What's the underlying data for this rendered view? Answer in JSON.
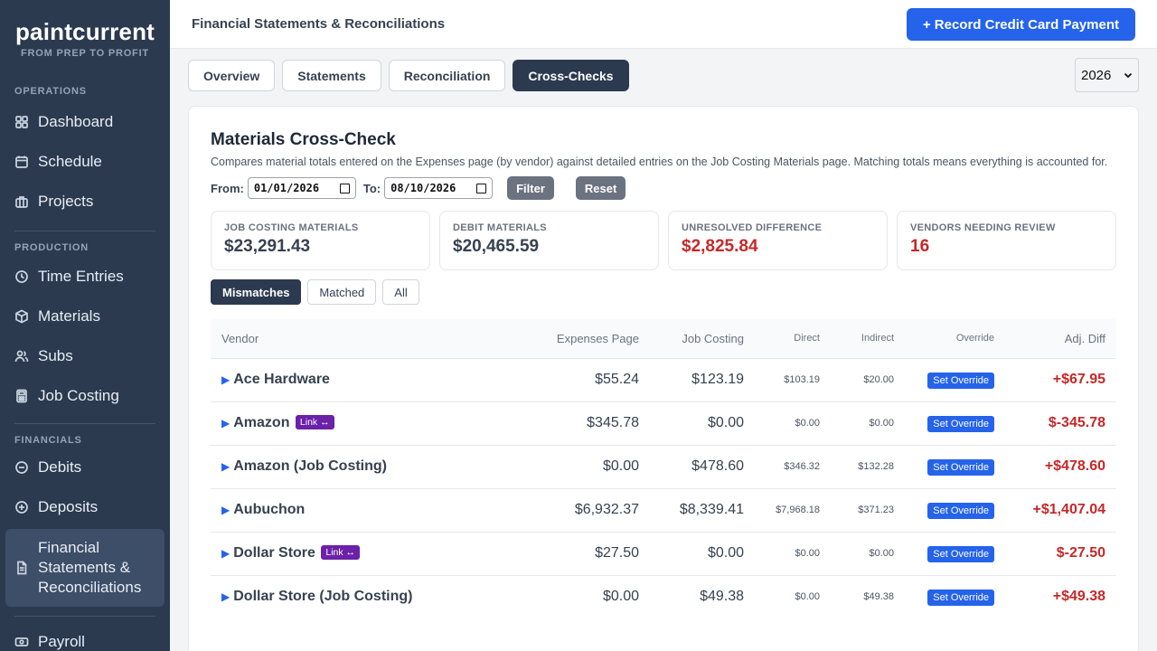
{
  "brand": {
    "name": "paintcurrent",
    "tagline": "FROM PREP TO PROFIT"
  },
  "sidebar": {
    "sections": [
      {
        "label": "OPERATIONS",
        "items": [
          {
            "label": "Dashboard",
            "icon": "grid-icon"
          },
          {
            "label": "Schedule",
            "icon": "calendar-icon"
          },
          {
            "label": "Projects",
            "icon": "briefcase-icon"
          }
        ]
      },
      {
        "label": "PRODUCTION",
        "items": [
          {
            "label": "Time Entries",
            "icon": "clock-icon"
          },
          {
            "label": "Materials",
            "icon": "box-icon"
          },
          {
            "label": "Subs",
            "icon": "users-icon"
          },
          {
            "label": "Job Costing",
            "icon": "calculator-icon"
          }
        ]
      },
      {
        "label": "FINANCIALS",
        "items": [
          {
            "label": "Debits",
            "icon": "minus-circle-icon"
          },
          {
            "label": "Deposits",
            "icon": "plus-circle-icon"
          },
          {
            "label": "Financial Statements & Reconciliations",
            "icon": "document-icon",
            "active": true
          }
        ]
      }
    ],
    "footer_item": {
      "label": "Payroll",
      "icon": "payroll-icon"
    }
  },
  "header": {
    "title": "Financial Statements & Reconciliations",
    "primary_button": "+ Record Credit Card Payment"
  },
  "tabs": [
    {
      "label": "Overview"
    },
    {
      "label": "Statements"
    },
    {
      "label": "Reconciliation"
    },
    {
      "label": "Cross-Checks",
      "active": true
    }
  ],
  "year_select": {
    "value": "2026"
  },
  "card": {
    "title": "Materials Cross-Check",
    "description": "Compares material totals entered on the Expenses page (by vendor) against detailed entries on the Job Costing Materials page. Matching totals means everything is accounted for.",
    "filter": {
      "from_label": "From:",
      "from_value": "01/01/2026",
      "to_label": "To:",
      "to_value": "08/10/2026",
      "filter_button": "Filter",
      "reset_button": "Reset"
    },
    "stats": [
      {
        "label": "JOB COSTING MATERIALS",
        "value": "$23,291.43",
        "red": false
      },
      {
        "label": "DEBIT MATERIALS",
        "value": "$20,465.59",
        "red": false
      },
      {
        "label": "UNRESOLVED DIFFERENCE",
        "value": "$2,825.84",
        "red": true
      },
      {
        "label": "VENDORS NEEDING REVIEW",
        "value": "16",
        "red": true
      }
    ],
    "view_toggle": [
      {
        "label": "Mismatches",
        "active": true
      },
      {
        "label": "Matched"
      },
      {
        "label": "All"
      }
    ],
    "table": {
      "columns": [
        "Vendor",
        "Expenses Page",
        "Job Costing",
        "Direct",
        "Indirect",
        "Override",
        "Adj. Diff"
      ],
      "override_label": "Set Override",
      "link_label": "Link ↔",
      "rows": [
        {
          "vendor": "Ace Hardware",
          "link": false,
          "expenses": "$55.24",
          "job_costing": "$123.19",
          "direct": "$103.19",
          "indirect": "$20.00",
          "diff": "+$67.95"
        },
        {
          "vendor": "Amazon",
          "link": true,
          "expenses": "$345.78",
          "job_costing": "$0.00",
          "direct": "$0.00",
          "indirect": "$0.00",
          "diff": "$-345.78"
        },
        {
          "vendor": "Amazon (Job Costing)",
          "link": false,
          "expenses": "$0.00",
          "job_costing": "$478.60",
          "direct": "$346.32",
          "indirect": "$132.28",
          "diff": "+$478.60"
        },
        {
          "vendor": "Aubuchon",
          "link": false,
          "expenses": "$6,932.37",
          "job_costing": "$8,339.41",
          "direct": "$7,968.18",
          "indirect": "$371.23",
          "diff": "+$1,407.04"
        },
        {
          "vendor": "Dollar Store",
          "link": true,
          "expenses": "$27.50",
          "job_costing": "$0.00",
          "direct": "$0.00",
          "indirect": "$0.00",
          "diff": "$-27.50"
        },
        {
          "vendor": "Dollar Store (Job Costing)",
          "link": false,
          "expenses": "$0.00",
          "job_costing": "$49.38",
          "direct": "$0.00",
          "indirect": "$49.38",
          "diff": "+$49.38"
        }
      ]
    }
  }
}
